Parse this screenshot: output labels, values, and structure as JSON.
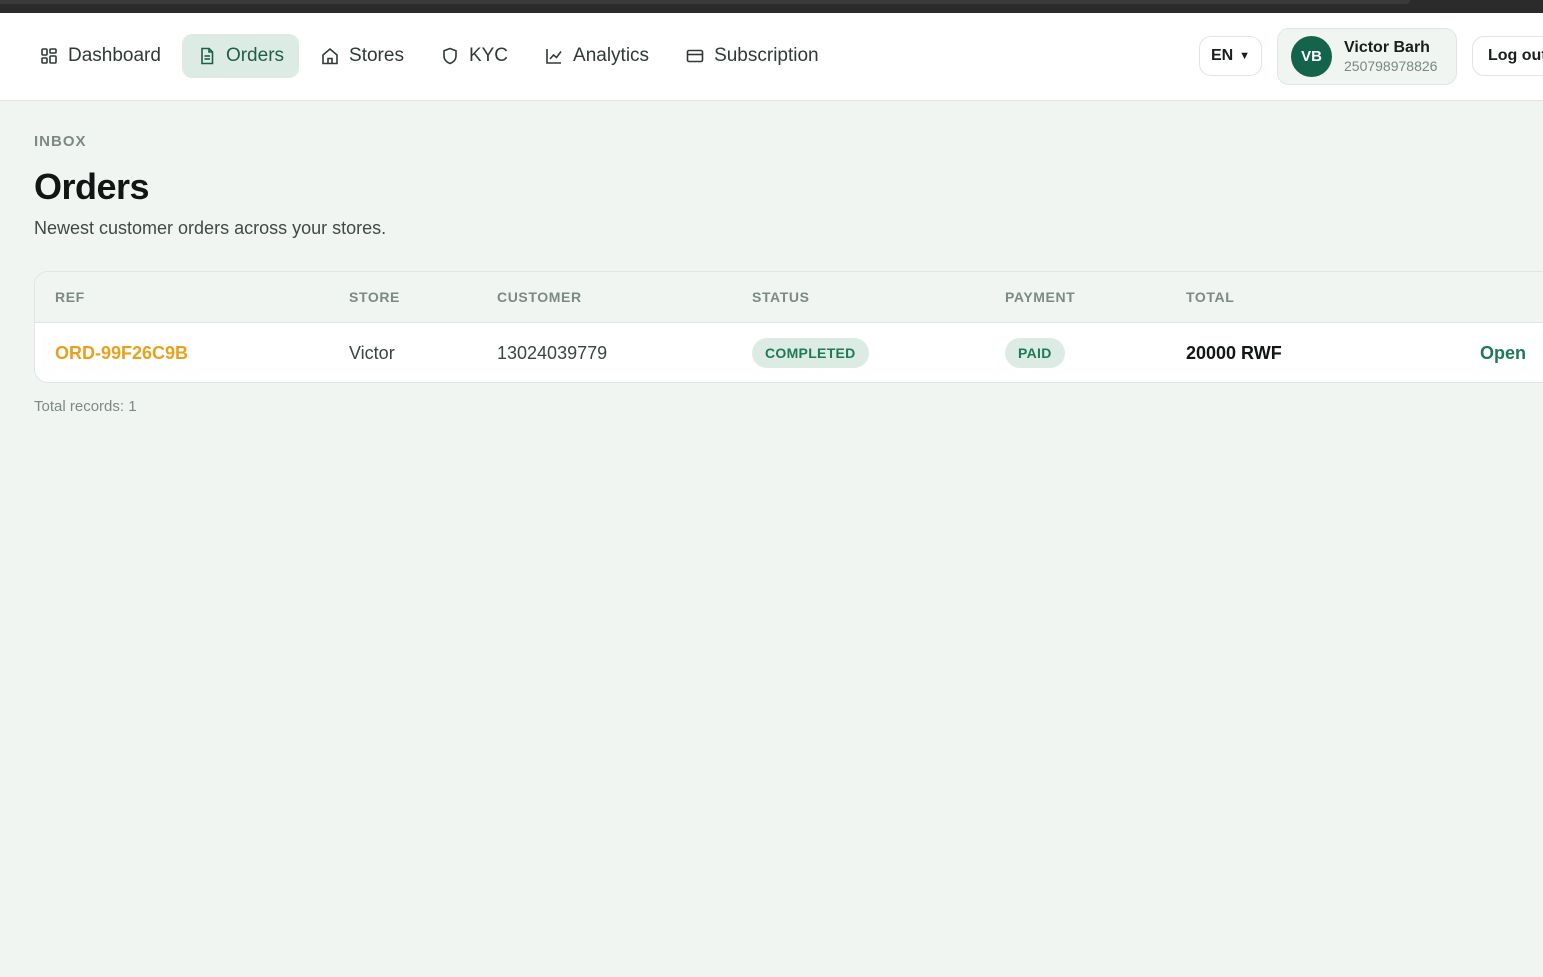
{
  "nav": {
    "items": [
      {
        "label": "Dashboard",
        "icon": "grid-icon",
        "active": false
      },
      {
        "label": "Orders",
        "icon": "document-icon",
        "active": true
      },
      {
        "label": "Stores",
        "icon": "home-icon",
        "active": false
      },
      {
        "label": "KYC",
        "icon": "shield-icon",
        "active": false
      },
      {
        "label": "Analytics",
        "icon": "line-chart-icon",
        "active": false
      },
      {
        "label": "Subscription",
        "icon": "credit-card-icon",
        "active": false
      }
    ]
  },
  "header": {
    "language": "EN",
    "user": {
      "initials": "VB",
      "name": "Victor Barh",
      "phone": "250798978826"
    },
    "logout_label": "Log out"
  },
  "page": {
    "eyebrow": "INBOX",
    "title": "Orders",
    "subtitle": "Newest customer orders across your stores."
  },
  "table": {
    "columns": [
      "REF",
      "STORE",
      "CUSTOMER",
      "STATUS",
      "PAYMENT",
      "TOTAL"
    ],
    "rows": [
      {
        "ref": "ORD-99F26C9B",
        "store": "Victor",
        "customer": "13024039779",
        "status": "COMPLETED",
        "payment": "PAID",
        "total": "20000 RWF",
        "action": "Open"
      }
    ]
  },
  "footer": {
    "records": "Total records: 1"
  },
  "colors": {
    "accent": "#13644a",
    "ref_link": "#e8a11c",
    "badge_bg": "#dcece4",
    "badge_text": "#1d7a55",
    "background": "#f0f5f2"
  }
}
